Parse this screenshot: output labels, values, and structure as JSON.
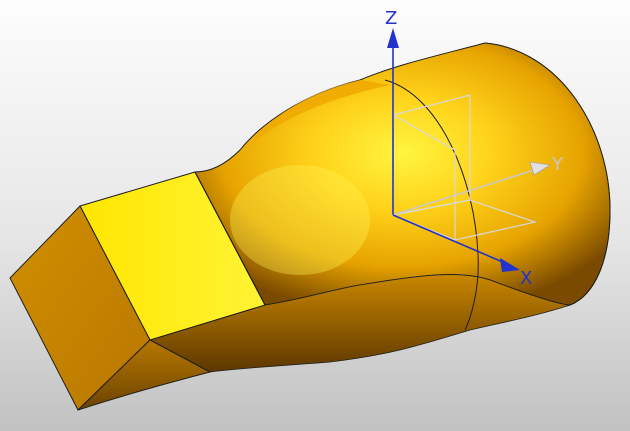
{
  "viewport": {
    "background_top": "#fdfdfd",
    "background_bottom": "#c4c4c4",
    "part_color": "#f5c300",
    "part_highlight": "#fff23a",
    "part_shadow": "#7a4c00",
    "edge_color": "#1e1e1e"
  },
  "axes": {
    "z_label": "Z",
    "y_label": "Y",
    "x_label": "X",
    "z_color": "#2233cc",
    "y_color": "#c8c8c8",
    "x_color": "#2233cc",
    "csys_line_color": "#d8d8d8"
  }
}
